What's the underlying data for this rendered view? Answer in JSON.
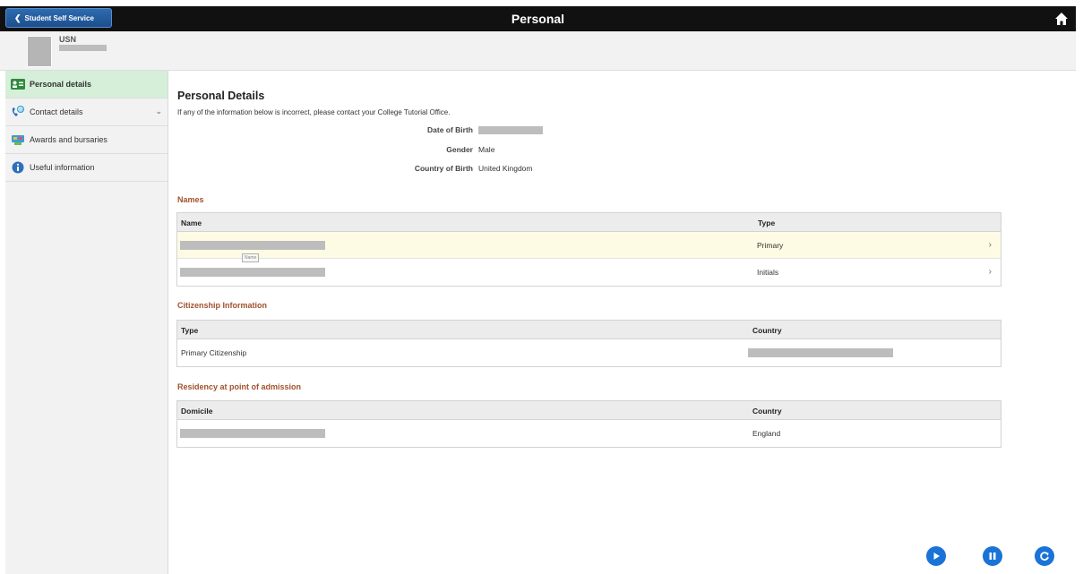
{
  "header": {
    "back_label": "Student Self Service",
    "title": "Personal"
  },
  "profile": {
    "usn_label": "USN"
  },
  "sidebar": {
    "items": [
      {
        "label": "Personal details",
        "icon": "id-card-icon"
      },
      {
        "label": "Contact details",
        "icon": "phone-contact-icon"
      },
      {
        "label": "Awards and bursaries",
        "icon": "awards-icon"
      },
      {
        "label": "Useful information",
        "icon": "info-icon"
      }
    ]
  },
  "main": {
    "title": "Personal Details",
    "intro": "If any of the information below is incorrect, please contact your College Tutorial Office.",
    "details": {
      "dob_label": "Date of Birth",
      "gender_label": "Gender",
      "gender_value": "Male",
      "country_birth_label": "Country of Birth",
      "country_birth_value": "United Kingdom"
    },
    "names": {
      "heading": "Names",
      "col_name": "Name",
      "col_type": "Type",
      "tooltip": "Name",
      "rows": [
        {
          "type": "Primary"
        },
        {
          "type": "Initials"
        }
      ]
    },
    "citizenship": {
      "heading": "Citizenship Information",
      "col_type": "Type",
      "col_country": "Country",
      "rows": [
        {
          "type": "Primary Citizenship"
        }
      ]
    },
    "residency": {
      "heading": "Residency at point of admission",
      "col_domicile": "Domicile",
      "col_country": "Country",
      "rows": [
        {
          "country": "England"
        }
      ]
    }
  },
  "controls": [
    "play-icon",
    "pause-icon",
    "refresh-icon"
  ],
  "colors": {
    "topbar": "#111111",
    "back_button": "#1c4f8d",
    "active_nav": "#d5efd9",
    "section_heading": "#a0522d",
    "control": "#1a73d6"
  }
}
